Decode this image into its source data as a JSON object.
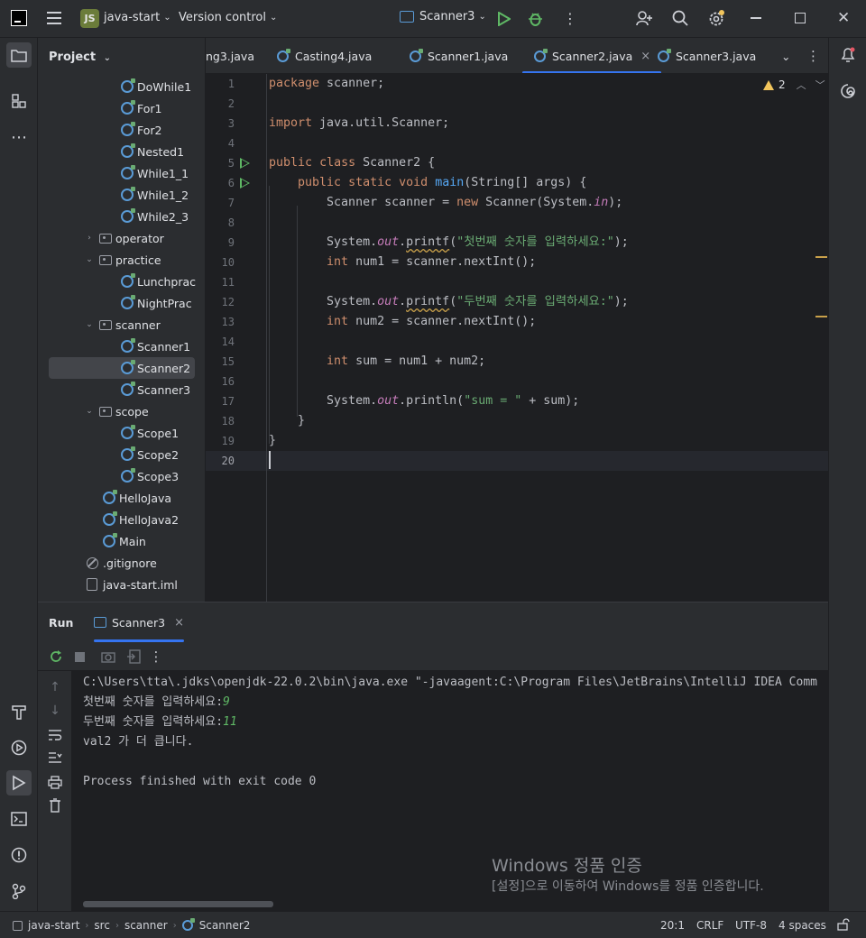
{
  "titlebar": {
    "project_badge": "JS",
    "project_name": "java-start",
    "vcs": "Version control",
    "run_config": "Scanner3"
  },
  "project_panel": {
    "title": "Project",
    "tree": [
      {
        "label": "DoWhile1",
        "type": "class",
        "depth": 4
      },
      {
        "label": "For1",
        "type": "class",
        "depth": 4
      },
      {
        "label": "For2",
        "type": "class",
        "depth": 4
      },
      {
        "label": "Nested1",
        "type": "class",
        "depth": 4
      },
      {
        "label": "While1_1",
        "type": "class",
        "depth": 4
      },
      {
        "label": "While1_2",
        "type": "class",
        "depth": 4
      },
      {
        "label": "While2_3",
        "type": "class",
        "depth": 4
      },
      {
        "label": "operator",
        "type": "package",
        "depth": 3,
        "expanded": false
      },
      {
        "label": "practice",
        "type": "package",
        "depth": 3,
        "expanded": true
      },
      {
        "label": "Lunchprac",
        "type": "class",
        "depth": 4
      },
      {
        "label": "NightPrac",
        "type": "class",
        "depth": 4
      },
      {
        "label": "scanner",
        "type": "package",
        "depth": 3,
        "expanded": true
      },
      {
        "label": "Scanner1",
        "type": "class",
        "depth": 4
      },
      {
        "label": "Scanner2",
        "type": "class",
        "depth": 4,
        "selected": true
      },
      {
        "label": "Scanner3",
        "type": "class",
        "depth": 4
      },
      {
        "label": "scope",
        "type": "package",
        "depth": 3,
        "expanded": true
      },
      {
        "label": "Scope1",
        "type": "class",
        "depth": 4
      },
      {
        "label": "Scope2",
        "type": "class",
        "depth": 4
      },
      {
        "label": "Scope3",
        "type": "class",
        "depth": 4
      },
      {
        "label": "HelloJava",
        "type": "class",
        "depth": 3
      },
      {
        "label": "HelloJava2",
        "type": "class",
        "depth": 3
      },
      {
        "label": "Main",
        "type": "class",
        "depth": 3
      },
      {
        "label": ".gitignore",
        "type": "ignore",
        "depth": 2
      },
      {
        "label": "java-start.iml",
        "type": "file",
        "depth": 2
      }
    ]
  },
  "tabs": [
    {
      "label": "ng3.java",
      "active": false
    },
    {
      "label": "Casting4.java",
      "active": false
    },
    {
      "label": "Scanner1.java",
      "active": false
    },
    {
      "label": "Scanner2.java",
      "active": true
    },
    {
      "label": "Scanner3.java",
      "active": false
    }
  ],
  "editor": {
    "warning_count": "2",
    "line_numbers": [
      "1",
      "2",
      "3",
      "4",
      "5",
      "6",
      "7",
      "8",
      "9",
      "10",
      "11",
      "12",
      "13",
      "14",
      "15",
      "16",
      "17",
      "18",
      "19",
      "20"
    ],
    "code": [
      "package scanner;",
      "",
      "import java.util.Scanner;",
      "",
      "public class Scanner2 {",
      "    public static void main(String[] args) {",
      "        Scanner scanner = new Scanner(System.in);",
      "",
      "        System.out.printf(\"첫번째 숫자를 입력하세요:\");",
      "        int num1 = scanner.nextInt();",
      "",
      "        System.out.printf(\"두번째 숫자를 입력하세요:\");",
      "        int num2 = scanner.nextInt();",
      "",
      "        int sum = num1 + num2;",
      "",
      "        System.out.println(\"sum = \" + sum);",
      "    }",
      "}",
      ""
    ]
  },
  "run_panel": {
    "title": "Run",
    "tab": "Scanner3",
    "console": {
      "cmd": "C:\\Users\\tta\\.jdks\\openjdk-22.0.2\\bin\\java.exe \"-javaagent:C:\\Program Files\\JetBrains\\IntelliJ IDEA Comm",
      "prompt1": "첫번째 숫자를 입력하세요:",
      "input1": "9",
      "prompt2": "두번째 숫자를 입력하세요:",
      "input2": "11",
      "line3": "val2 가 더 큽니다.",
      "exit": "Process finished with exit code 0"
    },
    "watermark_title": "Windows 정품 인증",
    "watermark_sub": "[설정]으로 이동하여 Windows를 정품 인증합니다."
  },
  "statusbar": {
    "crumbs": [
      "java-start",
      "src",
      "scanner",
      "Scanner2"
    ],
    "position": "20:1",
    "line_sep": "CRLF",
    "encoding": "UTF-8",
    "indent": "4 spaces"
  }
}
